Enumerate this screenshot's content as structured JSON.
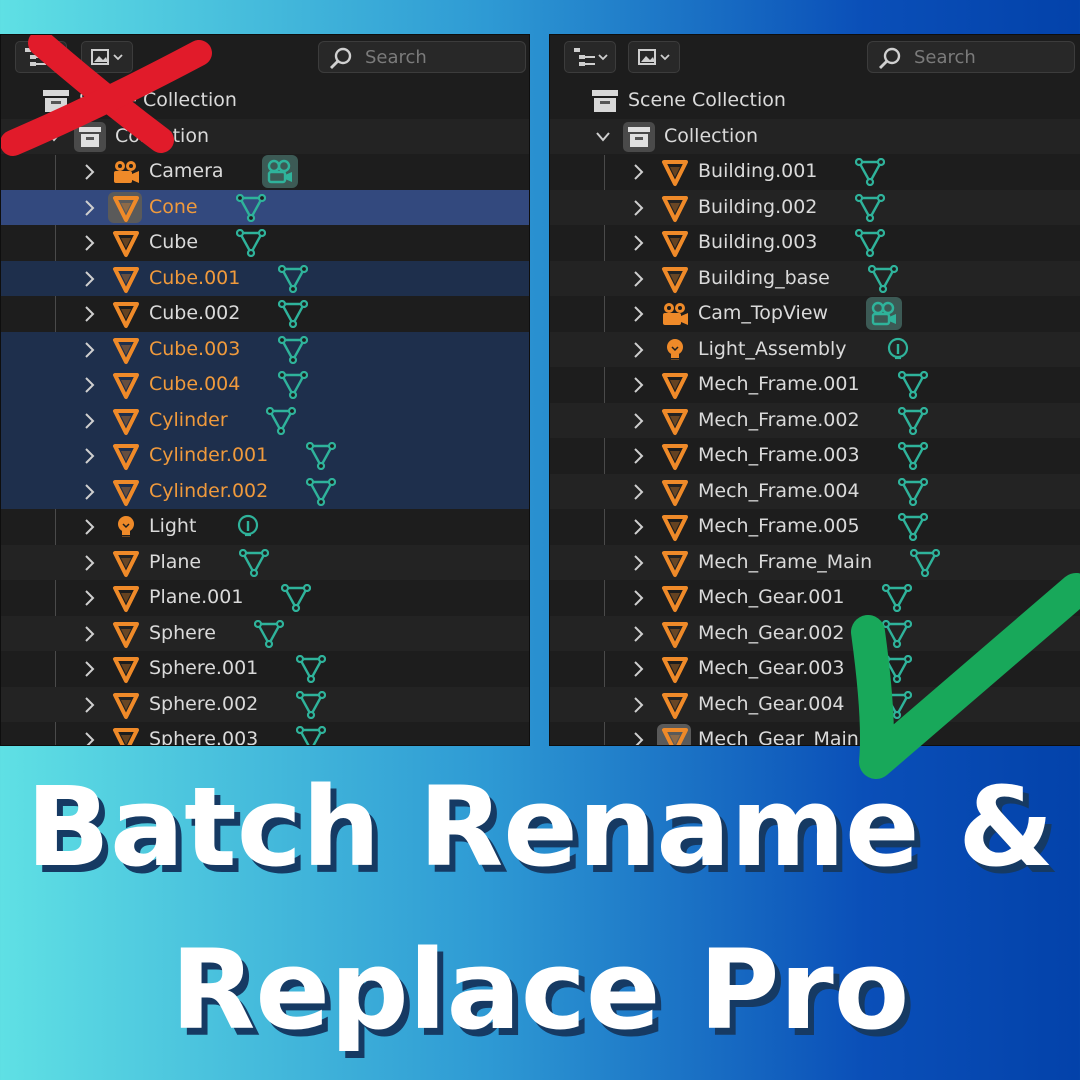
{
  "headline": {
    "line1": "Batch Rename &",
    "line2": "Replace Pro"
  },
  "colors": {
    "mesh_orange": "#ef8a29",
    "data_green": "#2fb39b",
    "selected_bg": "#1e2f4c",
    "active_bg": "#33497e",
    "check_green": "#18a85a",
    "cross_red": "#e11b2a"
  },
  "before_panel": {
    "search_placeholder": "Search",
    "scene_collection": "Scene Collection",
    "collection": "Collection",
    "objects": [
      {
        "name": "Camera",
        "type": "camera",
        "state": ""
      },
      {
        "name": "Cone",
        "type": "mesh",
        "state": "active"
      },
      {
        "name": "Cube",
        "type": "mesh",
        "state": ""
      },
      {
        "name": "Cube.001",
        "type": "mesh",
        "state": "selected"
      },
      {
        "name": "Cube.002",
        "type": "mesh",
        "state": ""
      },
      {
        "name": "Cube.003",
        "type": "mesh",
        "state": "selected"
      },
      {
        "name": "Cube.004",
        "type": "mesh",
        "state": "selected"
      },
      {
        "name": "Cylinder",
        "type": "mesh",
        "state": "selected"
      },
      {
        "name": "Cylinder.001",
        "type": "mesh",
        "state": "selected"
      },
      {
        "name": "Cylinder.002",
        "type": "mesh",
        "state": "selected"
      },
      {
        "name": "Light",
        "type": "light",
        "state": ""
      },
      {
        "name": "Plane",
        "type": "mesh",
        "state": ""
      },
      {
        "name": "Plane.001",
        "type": "mesh",
        "state": ""
      },
      {
        "name": "Sphere",
        "type": "mesh",
        "state": ""
      },
      {
        "name": "Sphere.001",
        "type": "mesh",
        "state": ""
      },
      {
        "name": "Sphere.002",
        "type": "mesh",
        "state": ""
      },
      {
        "name": "Sphere.003",
        "type": "mesh",
        "state": ""
      }
    ]
  },
  "after_panel": {
    "search_placeholder": "Search",
    "scene_collection": "Scene Collection",
    "collection": "Collection",
    "objects": [
      {
        "name": "Building.001",
        "type": "mesh",
        "state": ""
      },
      {
        "name": "Building.002",
        "type": "mesh",
        "state": ""
      },
      {
        "name": "Building.003",
        "type": "mesh",
        "state": ""
      },
      {
        "name": "Building_base",
        "type": "mesh",
        "state": ""
      },
      {
        "name": "Cam_TopView",
        "type": "camera",
        "state": ""
      },
      {
        "name": "Light_Assembly",
        "type": "light",
        "state": ""
      },
      {
        "name": "Mech_Frame.001",
        "type": "mesh",
        "state": ""
      },
      {
        "name": "Mech_Frame.002",
        "type": "mesh",
        "state": ""
      },
      {
        "name": "Mech_Frame.003",
        "type": "mesh",
        "state": ""
      },
      {
        "name": "Mech_Frame.004",
        "type": "mesh",
        "state": ""
      },
      {
        "name": "Mech_Frame.005",
        "type": "mesh",
        "state": ""
      },
      {
        "name": "Mech_Frame_Main",
        "type": "mesh",
        "state": ""
      },
      {
        "name": "Mech_Gear.001",
        "type": "mesh",
        "state": ""
      },
      {
        "name": "Mech_Gear.002",
        "type": "mesh",
        "state": ""
      },
      {
        "name": "Mech_Gear.003",
        "type": "mesh",
        "state": ""
      },
      {
        "name": "Mech_Gear.004",
        "type": "mesh",
        "state": ""
      },
      {
        "name": "Mech_Gear_Main",
        "type": "mesh",
        "state": "highlight"
      }
    ]
  }
}
